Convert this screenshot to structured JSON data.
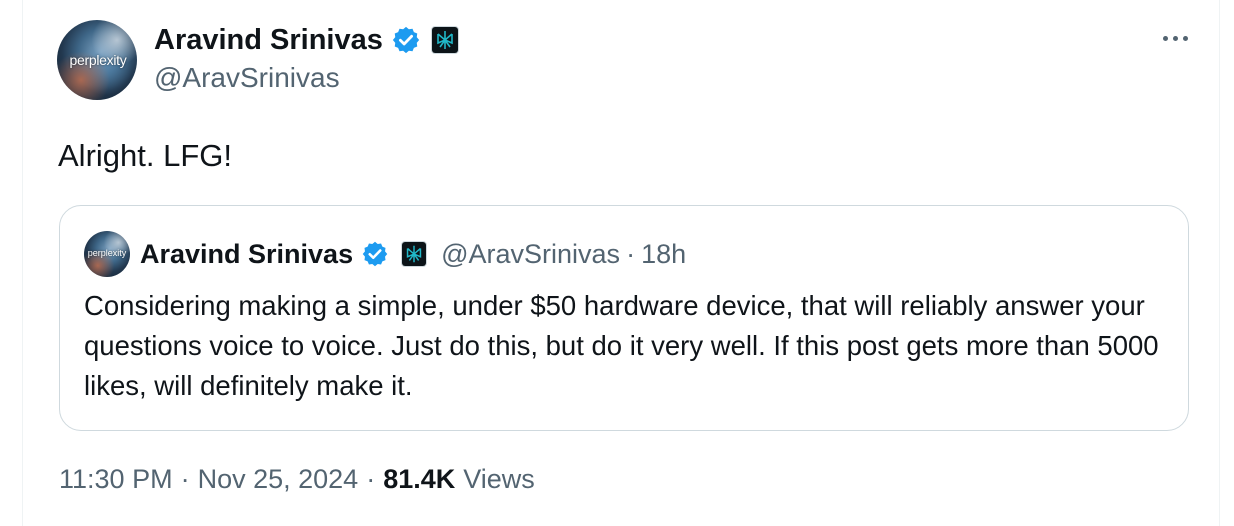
{
  "tweet": {
    "author": {
      "display_name": "Aravind Srinivas",
      "handle": "@AravSrinivas",
      "avatar_text": "perplexity",
      "verified_icon": "verified-badge-icon",
      "affiliation_icon": "perplexity-logo-icon"
    },
    "text": "Alright. LFG!",
    "more_icon": "more-options-icon",
    "quoted": {
      "display_name": "Aravind Srinivas",
      "handle": "@AravSrinivas",
      "separator": "·",
      "time": "18h",
      "avatar_text": "perplexity",
      "text": "Considering making a simple, under $50 hardware device, that will reliably answer your questions voice to voice. Just do this, but do it very well. If this post gets more than 5000 likes, will definitely make it."
    },
    "meta": {
      "time": "11:30 PM",
      "separator": "·",
      "date": "Nov 25, 2024",
      "views_count": "81.4K",
      "views_label": "Views"
    }
  },
  "colors": {
    "text_primary": "#0f1419",
    "text_secondary": "#536471",
    "verified_blue": "#1d9bf0",
    "border": "#cfd9de",
    "affiliation_teal": "#20808d"
  }
}
